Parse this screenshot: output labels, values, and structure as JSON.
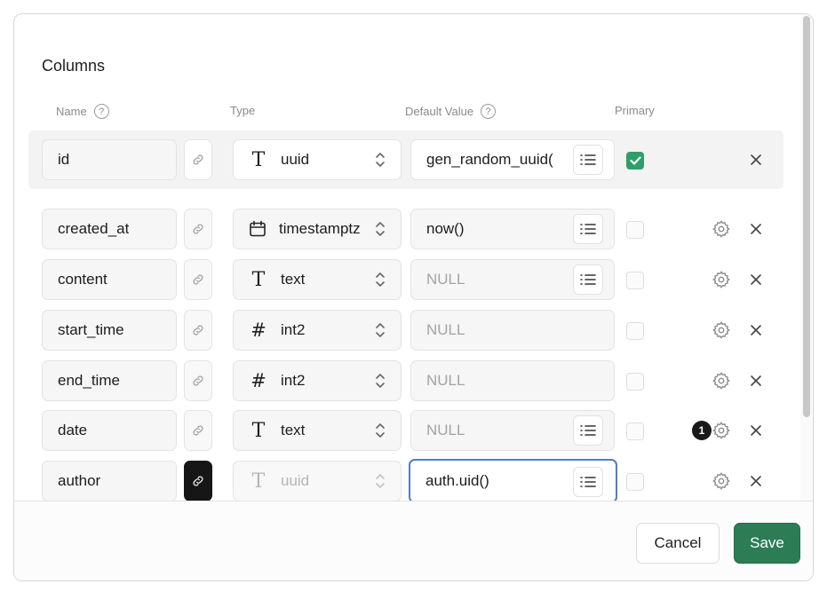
{
  "section_title": "Columns",
  "headers": {
    "name": "Name",
    "type": "Type",
    "default_value": "Default Value",
    "primary": "Primary"
  },
  "help_glyph": "?",
  "rows": [
    {
      "name": "id",
      "type_icon": "text-type-icon",
      "type": "uuid",
      "default": "gen_random_uuid(",
      "default_is_placeholder": false,
      "primary": true,
      "linked": false
    },
    {
      "name": "created_at",
      "type_icon": "calendar-icon",
      "type": "timestamptz",
      "default": "now()",
      "default_is_placeholder": false,
      "primary": false,
      "linked": false
    },
    {
      "name": "content",
      "type_icon": "text-type-icon",
      "type": "text",
      "default": "NULL",
      "default_is_placeholder": true,
      "primary": false,
      "linked": false
    },
    {
      "name": "start_time",
      "type_icon": "hash-icon",
      "type": "int2",
      "default": "NULL",
      "default_is_placeholder": true,
      "primary": false,
      "linked": false
    },
    {
      "name": "end_time",
      "type_icon": "hash-icon",
      "type": "int2",
      "default": "NULL",
      "default_is_placeholder": true,
      "primary": false,
      "linked": false
    },
    {
      "name": "date",
      "type_icon": "text-type-icon",
      "type": "text",
      "default": "NULL",
      "default_is_placeholder": true,
      "primary": false,
      "linked": false,
      "badge": "1"
    },
    {
      "name": "author",
      "type_icon": "text-type-icon",
      "type": "uuid",
      "default": "auth.uid()",
      "default_is_placeholder": false,
      "primary": false,
      "linked": true
    }
  ],
  "glyphs": {
    "text_type": "T",
    "hash": "#"
  },
  "footer": {
    "cancel_label": "Cancel",
    "save_label": "Save"
  },
  "colors": {
    "save_button": "#2c7d55",
    "checkbox_checked": "#2f9e6a",
    "focus_ring": "#4f7fc2"
  }
}
